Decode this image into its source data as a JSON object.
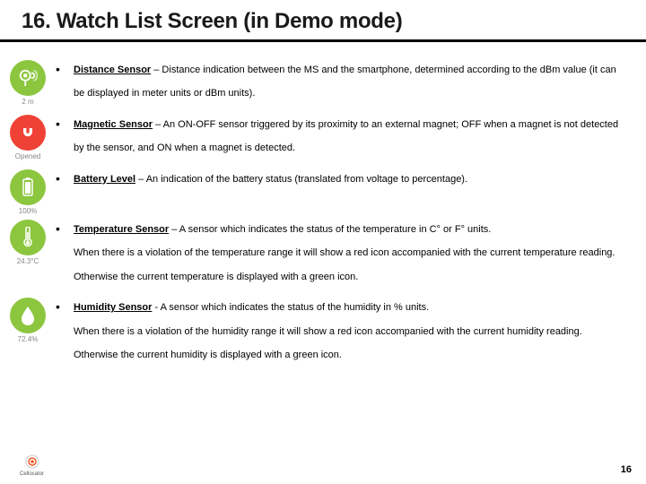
{
  "title": "16. Watch List Screen (in Demo mode)",
  "items": [
    {
      "term": "Distance Sensor",
      "desc": " – Distance indication between the MS and the smartphone, determined according to the dBm value (it can be displayed in meter units or dBm units).",
      "caption": "2 m"
    },
    {
      "term": "Magnetic Sensor",
      "desc": " – An ON-OFF sensor triggered by its proximity to an external magnet; OFF when a magnet is not detected by the sensor, and ON when a magnet is detected.",
      "caption": "Opened"
    },
    {
      "term": "Battery Level",
      "desc": " – An indication of the battery status (translated from voltage to percentage).",
      "caption": "100%"
    },
    {
      "term": "Temperature Sensor",
      "desc": " – A sensor which indicates the status of the temperature in C° or F° units.",
      "extra": "When there is a violation of the temperature range it will show a red icon accompanied with the current temperature reading. Otherwise the current temperature is displayed with a green icon.",
      "caption": "24.3°C"
    },
    {
      "term": "Humidity Sensor",
      "desc": " - A sensor which indicates the status of the humidity in % units.",
      "extra": "When there is a violation of the humidity range it will show a red icon accompanied with the current humidity reading. Otherwise the current humidity is displayed with a green icon.",
      "caption": "72.4%"
    }
  ],
  "logo_text": "Cellocator",
  "page_number": "16"
}
